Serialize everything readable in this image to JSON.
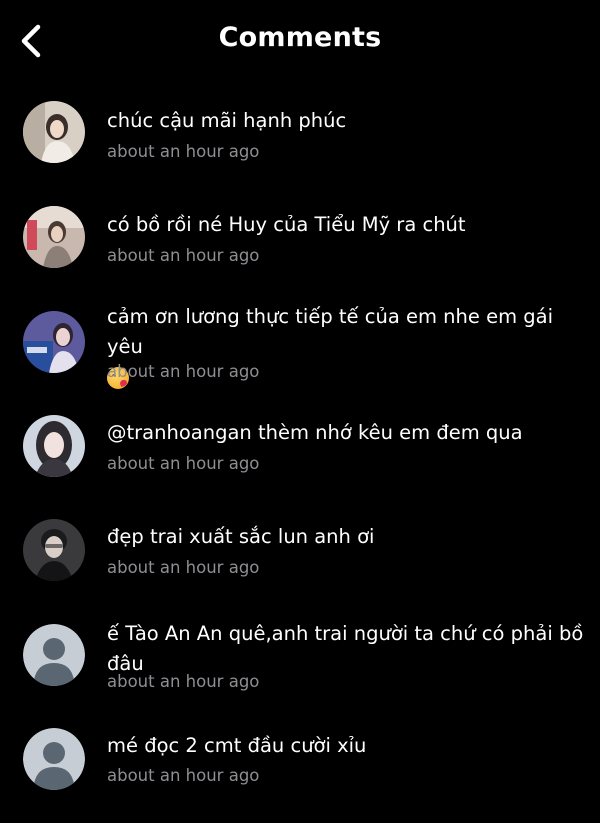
{
  "header": {
    "title": "Comments",
    "back_icon": "chevron-left-icon"
  },
  "colors": {
    "background": "#000000",
    "text": "#ffffff",
    "timestamp": "#8e8e93",
    "default_avatar_bg": "#c7cdd4",
    "default_avatar_fg": "#5b6673"
  },
  "comments": [
    {
      "text": "chúc cậu mãi hạnh phúc",
      "time": "about an hour ago",
      "avatar": "photo"
    },
    {
      "text": "có bồ rồi né Huy của Tiểu Mỹ ra chút",
      "time": "about an hour ago",
      "avatar": "photo"
    },
    {
      "text": "cảm ơn lương thực tiếp tế của em nhe em gái yêu",
      "emoji": "face-blowing-kiss-emoji",
      "time": "about an hour ago",
      "avatar": "photo"
    },
    {
      "text": "@tranhoangan thèm nhớ kêu em đem qua",
      "time": "about an hour ago",
      "avatar": "photo"
    },
    {
      "text": "đẹp trai xuất sắc lun anh ơi",
      "time": "about an hour ago",
      "avatar": "photo"
    },
    {
      "text": "ế Tào An An quê,anh trai người ta chứ có phải bồ đâu",
      "time": "about an hour ago",
      "avatar": "default"
    },
    {
      "text": "mé đọc 2 cmt đầu cười xỉu",
      "time": "about an hour ago",
      "avatar": "default"
    }
  ]
}
